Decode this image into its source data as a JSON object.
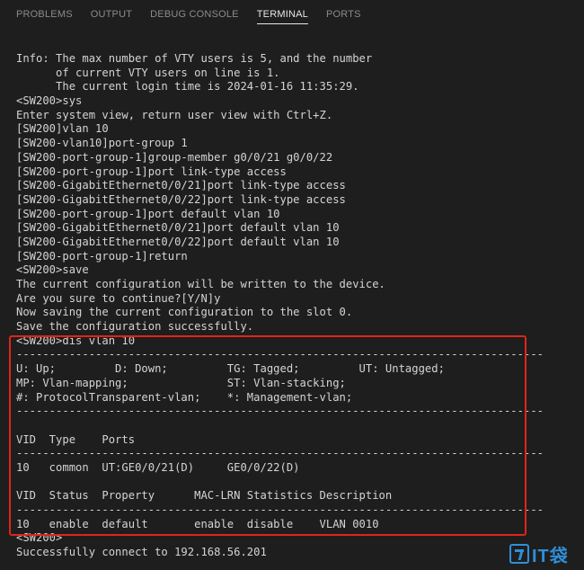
{
  "panel": {
    "tabs": [
      {
        "label": "PROBLEMS"
      },
      {
        "label": "OUTPUT"
      },
      {
        "label": "DEBUG CONSOLE"
      },
      {
        "label": "TERMINAL",
        "active": true
      },
      {
        "label": "PORTS"
      }
    ]
  },
  "terminal": {
    "lines": [
      "Info: The max number of VTY users is 5, and the number",
      "      of current VTY users on line is 1.",
      "      The current login time is 2024-01-16 11:35:29.",
      "<SW200>sys",
      "Enter system view, return user view with Ctrl+Z.",
      "[SW200]vlan 10",
      "[SW200-vlan10]port-group 1",
      "[SW200-port-group-1]group-member g0/0/21 g0/0/22",
      "[SW200-port-group-1]port link-type access",
      "[SW200-GigabitEthernet0/0/21]port link-type access",
      "[SW200-GigabitEthernet0/0/22]port link-type access",
      "[SW200-port-group-1]port default vlan 10",
      "[SW200-GigabitEthernet0/0/21]port default vlan 10",
      "[SW200-GigabitEthernet0/0/22]port default vlan 10",
      "[SW200-port-group-1]return",
      "<SW200>save",
      "The current configuration will be written to the device.",
      "Are you sure to continue?[Y/N]y",
      "Now saving the current configuration to the slot 0.",
      "Save the configuration successfully.",
      "<SW200>dis vlan 10",
      "--------------------------------------------------------------------------------",
      "U: Up;         D: Down;         TG: Tagged;         UT: Untagged;",
      "MP: Vlan-mapping;               ST: Vlan-stacking;",
      "#: ProtocolTransparent-vlan;    *: Management-vlan;",
      "--------------------------------------------------------------------------------",
      "",
      "VID  Type    Ports",
      "--------------------------------------------------------------------------------",
      "10   common  UT:GE0/0/21(D)     GE0/0/22(D)",
      "",
      "VID  Status  Property      MAC-LRN Statistics Description",
      "--------------------------------------------------------------------------------",
      "10   enable  default       enable  disable    VLAN 0010",
      "<SW200>",
      "Successfully connect to 192.168.56.201"
    ]
  },
  "watermark": {
    "text": "IT袋"
  },
  "colors": {
    "background": "#1e1e1e",
    "text": "#d4d4d4",
    "highlight_border": "#e0241b",
    "logo": "#2f8fd8"
  }
}
